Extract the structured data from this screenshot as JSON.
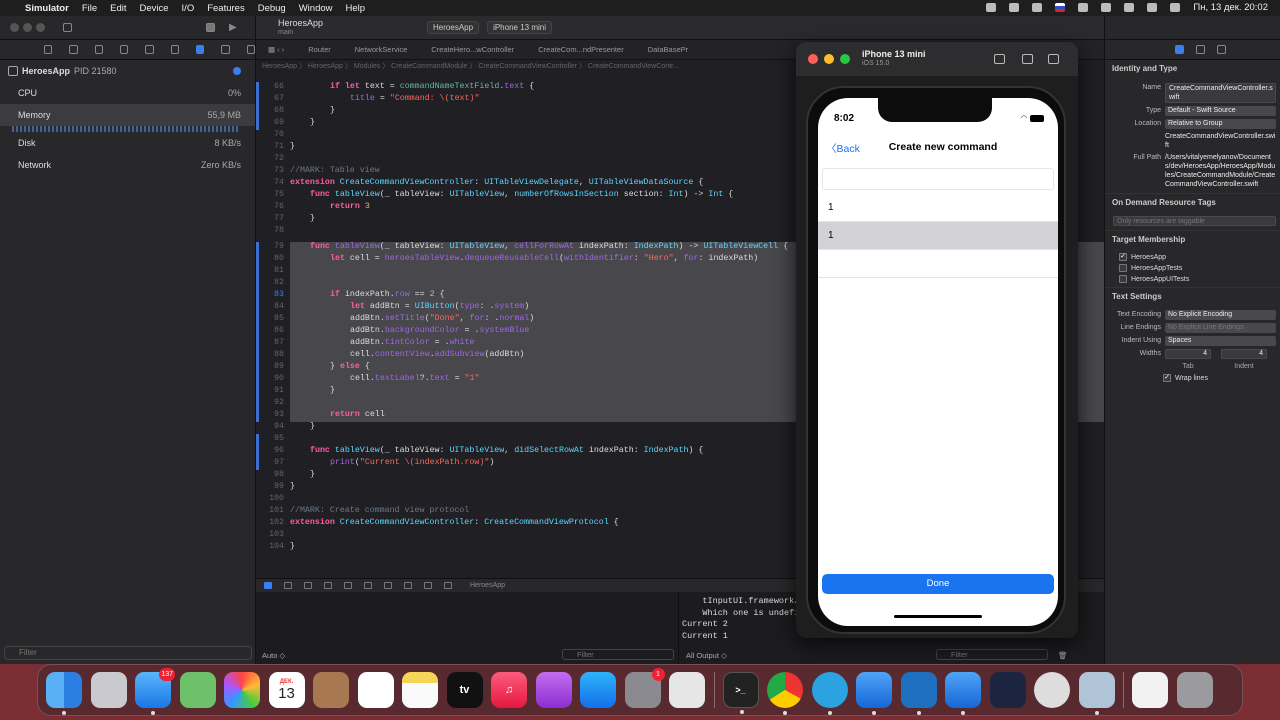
{
  "menubar": {
    "app_name": "Simulator",
    "items": [
      "File",
      "Edit",
      "Device",
      "I/O",
      "Features",
      "Debug",
      "Window",
      "Help"
    ],
    "datetime": "Пн, 13 дек.  20:02"
  },
  "debug_nav": {
    "process": "HeroesApp",
    "pid": "PID 21580",
    "rows": [
      {
        "label": "CPU",
        "value": "0%"
      },
      {
        "label": "Memory",
        "value": "55,9 MB"
      },
      {
        "label": "Disk",
        "value": "8 KB/s"
      },
      {
        "label": "Network",
        "value": "Zero KB/s"
      }
    ],
    "filter_placeholder": "Filter"
  },
  "editor": {
    "project": "HeroesApp",
    "branch": "main",
    "scheme": "HeroesApp",
    "destination": "iPhone 13 mini",
    "tabs": [
      "Router",
      "NetworkService",
      "CreateHero...wController",
      "CreateCom...ndPresenter",
      "DataBasePr"
    ],
    "breadcrumb": "HeroesApp 〉 HeroesApp 〉 Modules 〉 CreateCommandModule 〉 CreateCommandViewController 〉 CreateCommandViewContr..."
  },
  "debug_bar": {
    "target": "HeroesApp"
  },
  "console": {
    "lines": [
      "    tInputUI.framework/Te",
      "    Which one is undefined.",
      "Current 2",
      "Current 1"
    ],
    "left_scope": "Auto ◇",
    "left_filter": "Filter",
    "right_scope": "All Output ◇",
    "right_filter": "Filter"
  },
  "inspector": {
    "identity_title": "Identity and Type",
    "name_label": "Name",
    "name_value": "CreateCommandViewController.swift",
    "type_label": "Type",
    "type_value": "Default - Swift Source",
    "location_label": "Location",
    "location_value": "Relative to Group",
    "location_file": "CreateCommandViewController.swift",
    "fullpath_label": "Full Path",
    "fullpath_value": "/Users/vitalyemelyanov/Documents/dev/HeroesApp/HeroesApp/Modules/CreateCommandModule/CreateCommandViewController.swift",
    "odr_title": "On Demand Resource Tags",
    "odr_placeholder": "Only resources are taggable",
    "target_title": "Target Membership",
    "targets": [
      {
        "name": "HeroesApp",
        "checked": true
      },
      {
        "name": "HeroesAppTests",
        "checked": false
      },
      {
        "name": "HeroesAppUITests",
        "checked": false
      }
    ],
    "text_title": "Text Settings",
    "encoding_label": "Text Encoding",
    "encoding_value": "No Explicit Encoding",
    "line_endings_label": "Line Endings",
    "line_endings_value": "No Explicit Line Endings",
    "indent_label": "Indent Using",
    "indent_value": "Spaces",
    "widths_label": "Widths",
    "tab_value": "4",
    "indent_width_value": "4",
    "tab_caption": "Tab",
    "indent_caption": "Indent",
    "wrap_label": "Wrap lines"
  },
  "simulator": {
    "device": "iPhone 13 mini",
    "os": "iOS 15.0",
    "time": "8:02",
    "back_label": "Back",
    "title": "Create new command",
    "cells": [
      "1",
      "1"
    ],
    "done_label": "Done"
  },
  "dock": {
    "mail_badge": "137",
    "calendar_month": "ДЕК.",
    "calendar_day": "13",
    "settings_badge": "1",
    "tv_label": "tv"
  },
  "colors": {
    "accent": "#1a74f0",
    "keyword": "#fc5fa3",
    "type": "#5dd8ff",
    "string": "#fc6a5d",
    "comment": "#6c7986",
    "number": "#d0bf69",
    "desktop": "#7a2e34"
  }
}
